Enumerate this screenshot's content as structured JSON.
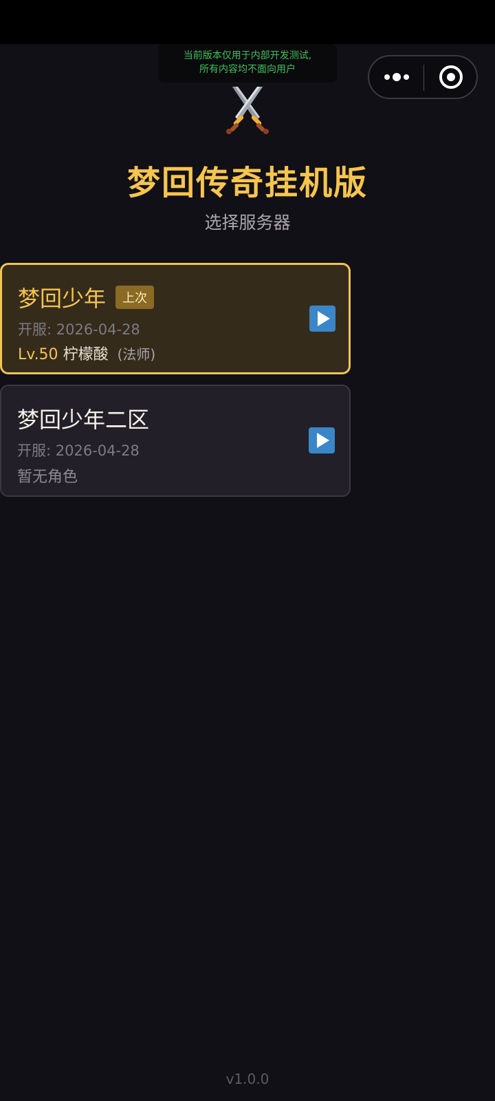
{
  "notice": {
    "line1": "当前版本仅用于内部开发测试,",
    "line2": "所有内容均不面向用户"
  },
  "header": {
    "icon": "crossed-swords-icon",
    "title": "梦回传奇挂机版",
    "subtitle": "选择服务器"
  },
  "servers": [
    {
      "name": "梦回少年",
      "badge": "上次",
      "date": "开服: 2026-04-28",
      "level": "Lv.50",
      "character": "柠檬酸",
      "class": "(法师)"
    },
    {
      "name": "梦回少年二区",
      "date": "开服: 2026-04-28",
      "no_role": "暂无角色"
    }
  ],
  "version": "v1.0.0",
  "colors": {
    "background": "#111016",
    "accent": "#f6c54f",
    "notice": "#3fc05a",
    "play": "#3a86c9"
  }
}
